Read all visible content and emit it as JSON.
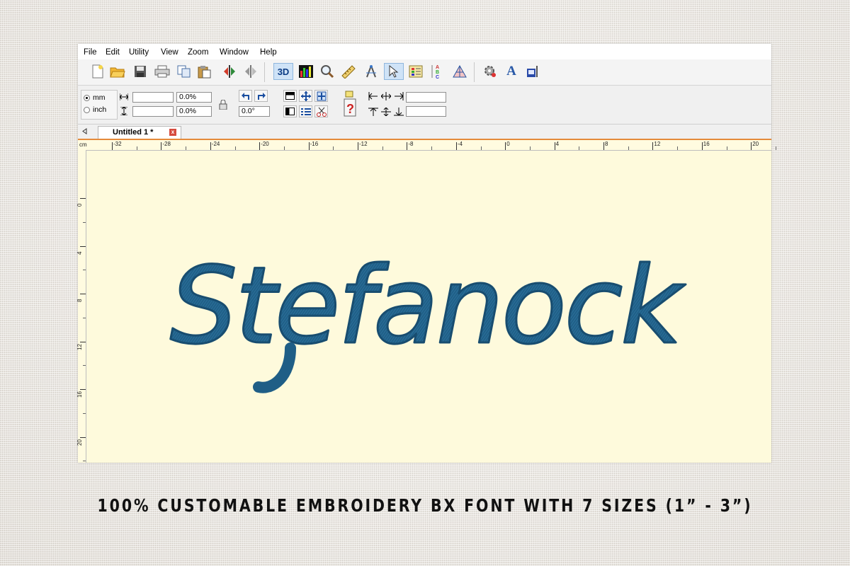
{
  "menu": [
    "File",
    "Edit",
    "Utility",
    "View",
    "Zoom",
    "Window",
    "Help"
  ],
  "toolbar": {
    "view_3d_label": "3D",
    "icons": [
      "new-file-icon",
      "open-folder-icon",
      "save-icon",
      "print-icon",
      "copy-icon",
      "paste-icon",
      "mirror-icon",
      "rotate-icon",
      "3d-view-icon",
      "color-bars-icon",
      "magnifier-icon",
      "ruler-icon",
      "compass-icon",
      "pointer-icon",
      "color-list-icon",
      "abc-lettering-icon",
      "shape-icon",
      "settings-icon",
      "text-A-icon",
      "machine-icon"
    ]
  },
  "params": {
    "unit_mm": "mm",
    "unit_inch": "inch",
    "width_scale": "0.0%",
    "height_scale": "0.0%",
    "rotation": "0.0°"
  },
  "tab": {
    "title": "Untitled 1 *",
    "close": "x"
  },
  "ruler": {
    "unit": "cm",
    "h_ticks": [
      "-32",
      "-28",
      "-24",
      "-20",
      "-16",
      "-12",
      "-8",
      "-4",
      "0",
      "4",
      "8",
      "12",
      "16",
      "20"
    ],
    "v_ticks": [
      "0",
      "4",
      "8",
      "12",
      "16",
      "20"
    ]
  },
  "design": {
    "text": "Stefanock",
    "thread_color": "#1f5e86"
  },
  "caption": "100% CUSTOMABLE EMBROIDERY BX FONT WITH 7 SIZES (1” -  3”)"
}
